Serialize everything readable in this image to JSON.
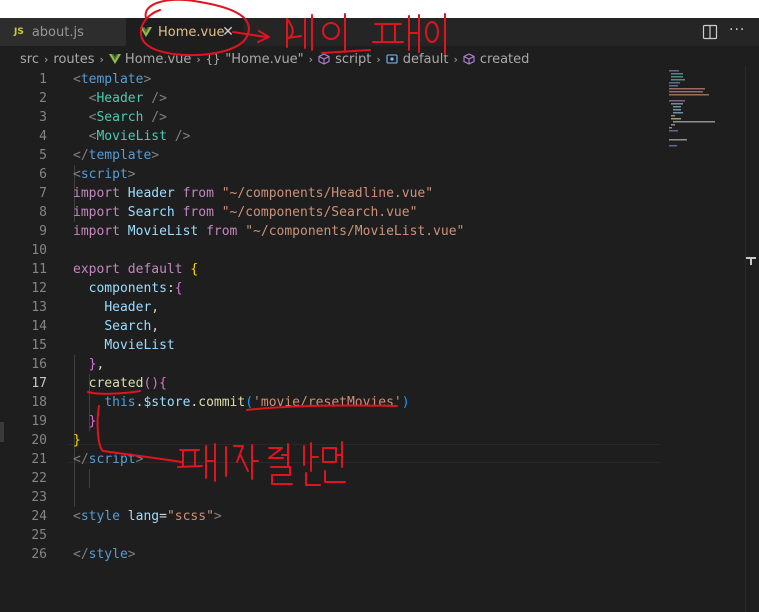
{
  "tabs": [
    {
      "icon": "js-icon",
      "icon_label": "JS",
      "label": "about.js",
      "active": false
    },
    {
      "icon": "vue-icon",
      "label": "Home.vue",
      "active": true
    }
  ],
  "tab_close_glyph": "✕",
  "editor_actions": {
    "split_icon": "split-editor-icon",
    "more_icon": "more-actions-icon",
    "more_glyph": "···"
  },
  "breadcrumb": [
    {
      "label": "src"
    },
    {
      "label": "routes"
    },
    {
      "label": "Home.vue",
      "icon": "vue-icon"
    },
    {
      "label": "\"Home.vue\"",
      "icon": "braces-icon",
      "icon_text": "{}"
    },
    {
      "label": "script",
      "icon": "cube-icon"
    },
    {
      "label": "default",
      "icon": "object-icon"
    },
    {
      "label": "created",
      "icon": "cube-icon"
    }
  ],
  "breadcrumb_separator": "›",
  "editor": {
    "active_line": 17,
    "line_numbers": [
      "1",
      "2",
      "3",
      "4",
      "5",
      "6",
      "7",
      "8",
      "9",
      "10",
      "11",
      "12",
      "13",
      "14",
      "15",
      "16",
      "17",
      "18",
      "19",
      "20",
      "21",
      "22",
      "23",
      "24",
      "25",
      "26"
    ],
    "lines": [
      [
        [
          "<",
          "tag"
        ],
        [
          "template",
          "name"
        ],
        [
          ">",
          "tag"
        ]
      ],
      [
        [
          "  ",
          "def"
        ],
        [
          "<",
          "tag"
        ],
        [
          "Header",
          "comp"
        ],
        [
          " />",
          "tag"
        ]
      ],
      [
        [
          "  ",
          "def"
        ],
        [
          "<",
          "tag"
        ],
        [
          "Search",
          "comp"
        ],
        [
          " />",
          "tag"
        ]
      ],
      [
        [
          "  ",
          "def"
        ],
        [
          "<",
          "tag"
        ],
        [
          "MovieList",
          "comp"
        ],
        [
          " />",
          "tag"
        ]
      ],
      [
        [
          "</",
          "tag"
        ],
        [
          "template",
          "name"
        ],
        [
          ">",
          "tag"
        ]
      ],
      [
        [
          "<",
          "tag"
        ],
        [
          "script",
          "name"
        ],
        [
          ">",
          "tag"
        ]
      ],
      [
        [
          "import",
          "kw"
        ],
        [
          " ",
          "def"
        ],
        [
          "Header",
          "var"
        ],
        [
          " ",
          "def"
        ],
        [
          "from",
          "kw"
        ],
        [
          " ",
          "def"
        ],
        [
          "\"~/components/Headline.vue\"",
          "str"
        ]
      ],
      [
        [
          "import",
          "kw"
        ],
        [
          " ",
          "def"
        ],
        [
          "Search",
          "var"
        ],
        [
          " ",
          "def"
        ],
        [
          "from",
          "kw"
        ],
        [
          " ",
          "def"
        ],
        [
          "\"~/components/Search.vue\"",
          "str"
        ]
      ],
      [
        [
          "import",
          "kw"
        ],
        [
          " ",
          "def"
        ],
        [
          "MovieList",
          "var"
        ],
        [
          " ",
          "def"
        ],
        [
          "from",
          "kw"
        ],
        [
          " ",
          "def"
        ],
        [
          "\"~/components/MovieList.vue\"",
          "str"
        ]
      ],
      [],
      [
        [
          "export",
          "kw"
        ],
        [
          " ",
          "def"
        ],
        [
          "default",
          "kw"
        ],
        [
          " ",
          "def"
        ],
        [
          "{",
          "br1"
        ]
      ],
      [
        [
          "  ",
          "def"
        ],
        [
          "components",
          "var"
        ],
        [
          ":",
          "def"
        ],
        [
          "{",
          "br2"
        ]
      ],
      [
        [
          "    ",
          "def"
        ],
        [
          "Header",
          "var"
        ],
        [
          ",",
          "def"
        ]
      ],
      [
        [
          "    ",
          "def"
        ],
        [
          "Search",
          "var"
        ],
        [
          ",",
          "def"
        ]
      ],
      [
        [
          "    ",
          "def"
        ],
        [
          "MovieList",
          "var"
        ]
      ],
      [
        [
          "  ",
          "def"
        ],
        [
          "}",
          "br2"
        ],
        [
          ",",
          "def"
        ]
      ],
      [
        [
          "  ",
          "def"
        ],
        [
          "created",
          "fn"
        ],
        [
          "()",
          "br2"
        ],
        [
          "{",
          "br2"
        ]
      ],
      [
        [
          "    ",
          "def"
        ],
        [
          "this",
          "this"
        ],
        [
          ".",
          "def"
        ],
        [
          "$store",
          "var"
        ],
        [
          ".",
          "def"
        ],
        [
          "commit",
          "fn"
        ],
        [
          "(",
          "br3"
        ],
        [
          "'movie/resetMovies'",
          "str"
        ],
        [
          ")",
          "br3"
        ]
      ],
      [
        [
          "  ",
          "def"
        ],
        [
          "}",
          "br2"
        ]
      ],
      [
        [
          "}",
          "br1"
        ]
      ],
      [
        [
          "</",
          "tag"
        ],
        [
          "script",
          "name"
        ],
        [
          ">",
          "tag"
        ]
      ],
      [],
      [],
      [
        [
          "<",
          "tag"
        ],
        [
          "style",
          "name"
        ],
        [
          " ",
          "def"
        ],
        [
          "lang",
          "attr"
        ],
        [
          "=",
          "def"
        ],
        [
          "\"scss\"",
          "str"
        ],
        [
          ">",
          "tag"
        ]
      ],
      [],
      [
        [
          "</",
          "tag"
        ],
        [
          "style",
          "name"
        ],
        [
          ">",
          "tag"
        ]
      ]
    ]
  },
  "colors": {
    "editor_bg": "#1e1e1e",
    "tab_bar_bg": "#252526",
    "keyword": "#c586c0",
    "tag_name": "#569cd6",
    "component": "#4ec9b0",
    "string": "#ce9178",
    "variable": "#9cdcfe",
    "function": "#dcdcaa",
    "annotation": "#e0141e"
  },
  "annotations": {
    "icon": "handwritten-annotation-icon"
  }
}
